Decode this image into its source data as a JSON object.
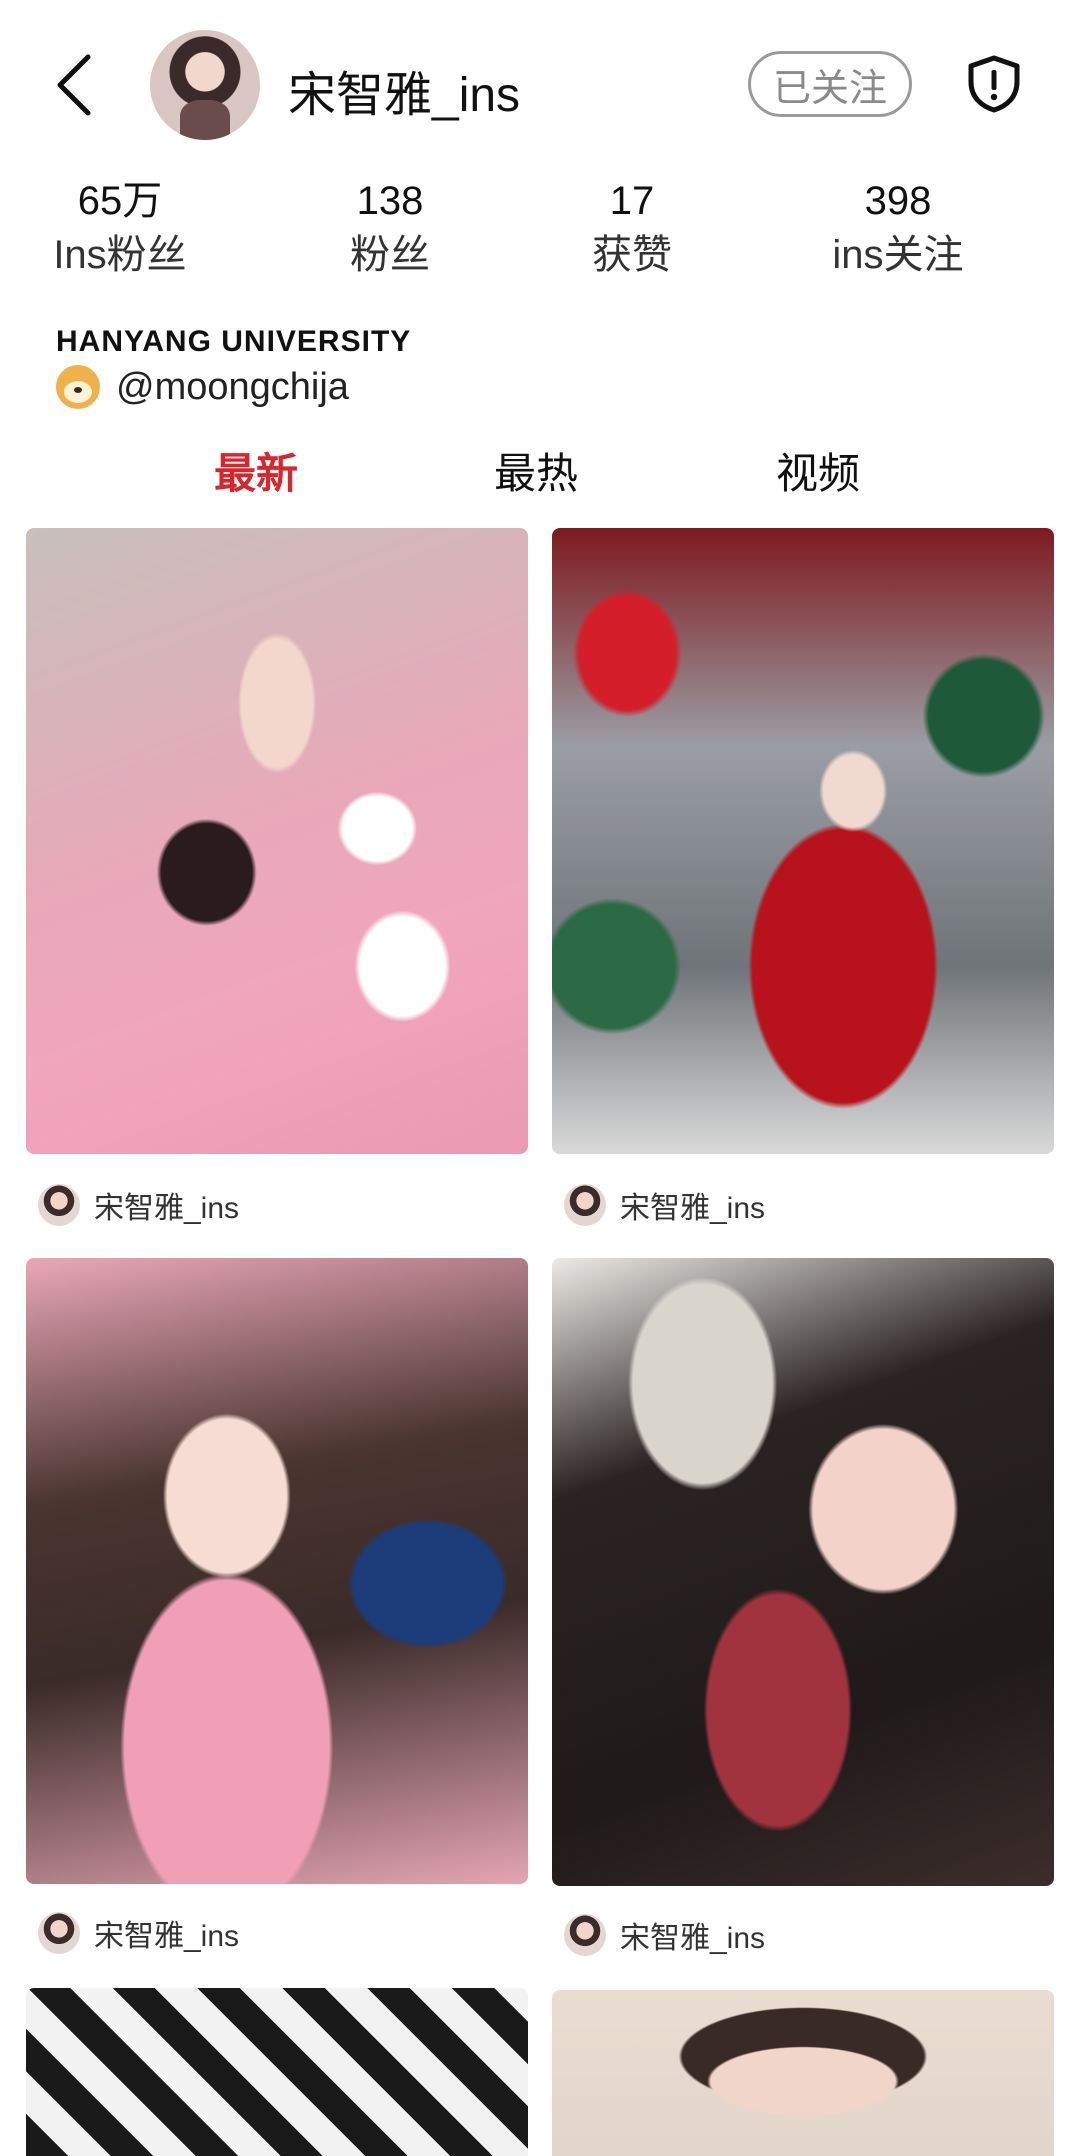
{
  "header": {
    "username": "宋智雅_ins",
    "follow_label": "已关注"
  },
  "stats": [
    {
      "value": "65万",
      "label": "Ins粉丝"
    },
    {
      "value": "138",
      "label": "粉丝"
    },
    {
      "value": "17",
      "label": "获赞"
    },
    {
      "value": "398",
      "label": "ins关注"
    }
  ],
  "bio": {
    "line1": "HANYANG UNIVERSITY",
    "line2": "@moongchija"
  },
  "tabs": [
    {
      "label": "最新",
      "active": true
    },
    {
      "label": "最热",
      "active": false
    },
    {
      "label": "视频",
      "active": false
    }
  ],
  "posts": [
    {
      "author": "宋智雅_ins"
    },
    {
      "author": "宋智雅_ins"
    },
    {
      "author": "宋智雅_ins"
    },
    {
      "author": "宋智雅_ins"
    }
  ],
  "colors": {
    "accent": "#d9262c",
    "text": "#111111",
    "muted": "#8a8a8a"
  },
  "icons": {
    "back": "chevron-left-icon",
    "report": "shield-exclamation-icon"
  }
}
